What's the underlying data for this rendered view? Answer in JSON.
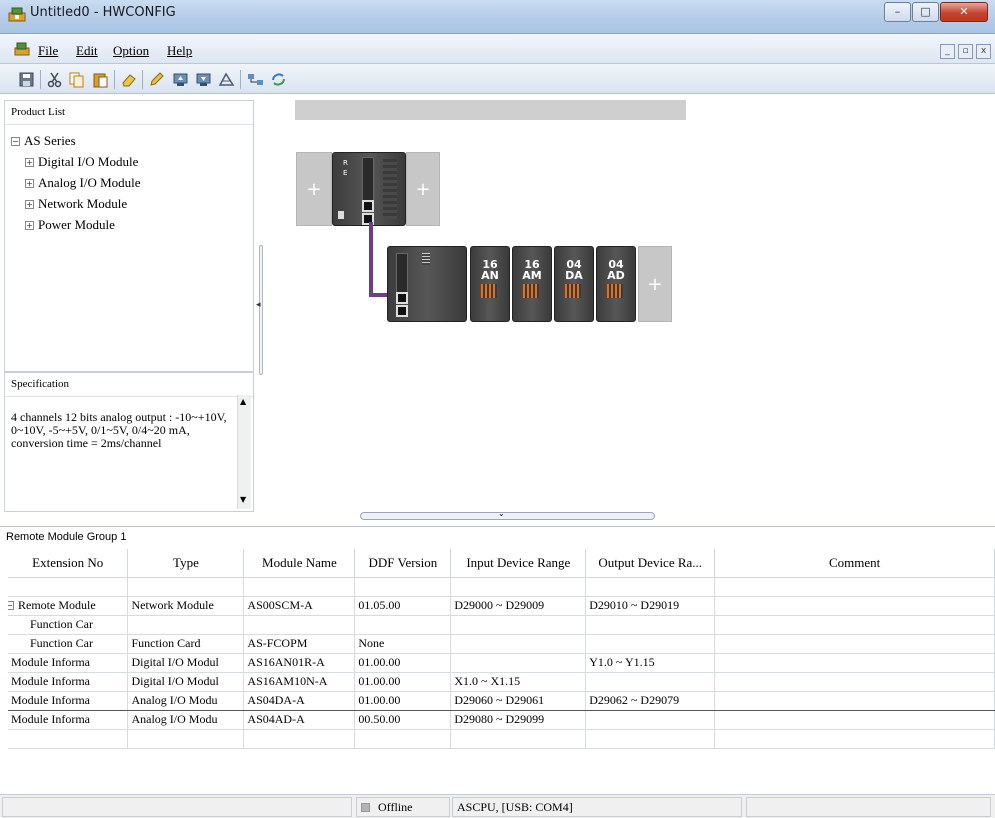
{
  "window": {
    "title": "Untitled0 - HWCONFIG",
    "min_label": "–",
    "max_label": "□",
    "close_label": "✕"
  },
  "menu": {
    "items": [
      "File",
      "Edit",
      "Option",
      "Help"
    ],
    "mdi": [
      "_",
      "▫",
      "x"
    ]
  },
  "toolbar": {
    "icons": [
      "save-icon",
      "cut-icon",
      "copy-icon",
      "paste-icon",
      "eraser-icon",
      "pencil-icon",
      "upload-icon",
      "download-icon",
      "scan-icon",
      "network-icon",
      "refresh-icon"
    ]
  },
  "product_list": {
    "title": "Product List",
    "root": "AS Series",
    "children": [
      "Digital I/O Module",
      "Analog I/O Module",
      "Network Module",
      "Power Module"
    ]
  },
  "specification": {
    "title": "Specification",
    "text": "4 channels 12 bits analog output : -10~+10V, 0~10V, -5~+5V, 0/1~5V, 0/4~20 mA, conversion time = 2ms/channel"
  },
  "canvas": {
    "cpu_leds": [
      "R",
      "E"
    ],
    "add_symbol": "+",
    "modules": [
      "16 AN",
      "16 AM",
      "04 DA",
      "04 AD"
    ]
  },
  "grid": {
    "title": "Remote Module Group 1",
    "columns": [
      "Extension No",
      "Type",
      "Module Name",
      "DDF Version",
      "Input Device Range",
      "Output Device Ra...",
      "Comment"
    ],
    "rows": [
      {
        "ext": "",
        "type": "",
        "name": "",
        "ddf": "",
        "input": "",
        "output": "",
        "comment": ""
      },
      {
        "ext": "Remote Module",
        "type": "Network Module",
        "name": "AS00SCM-A",
        "ddf": "01.05.00",
        "input": "D29000 ~ D29009",
        "output": "D29010 ~ D29019",
        "comment": ""
      },
      {
        "ext": "Function Car",
        "type": "",
        "name": "",
        "ddf": "",
        "input": "",
        "output": "",
        "comment": ""
      },
      {
        "ext": "Function Car",
        "type": "Function Card",
        "name": "AS-FCOPM",
        "ddf": "None",
        "input": "",
        "output": "",
        "comment": ""
      },
      {
        "ext": "Module Informa",
        "type": "Digital I/O Modul",
        "name": "AS16AN01R-A",
        "ddf": "01.00.00",
        "input": "",
        "output": "Y1.0 ~ Y1.15",
        "comment": ""
      },
      {
        "ext": "Module Informa",
        "type": "Digital I/O Modul",
        "name": "AS16AM10N-A",
        "ddf": "01.00.00",
        "input": "X1.0 ~ X1.15",
        "output": "",
        "comment": ""
      },
      {
        "ext": "Module Informa",
        "type": "Analog I/O Modu",
        "name": "AS04DA-A",
        "ddf": "01.00.00",
        "input": "D29060 ~ D29061",
        "output": "D29062 ~ D29079",
        "comment": ""
      },
      {
        "ext": "Module Informa",
        "type": "Analog I/O Modu",
        "name": "AS04AD-A",
        "ddf": "00.50.00",
        "input": "D29080 ~ D29099",
        "output": "",
        "comment": ""
      },
      {
        "ext": "",
        "type": "",
        "name": "",
        "ddf": "",
        "input": "",
        "output": "",
        "comment": ""
      }
    ]
  },
  "status": {
    "mode": "Offline",
    "connection": "ASCPU, [USB: COM4]"
  }
}
